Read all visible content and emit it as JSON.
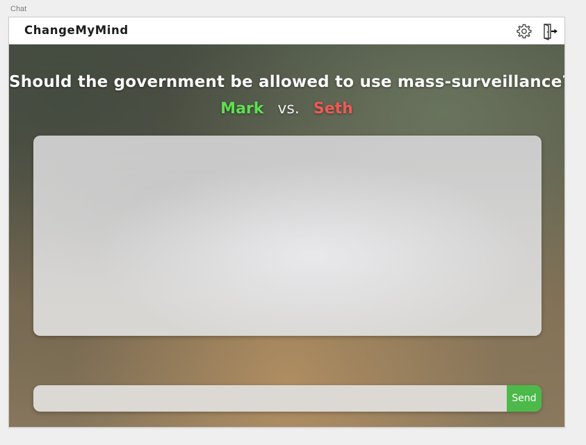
{
  "artboard": {
    "label": "Chat"
  },
  "header": {
    "brand": "ChangeMyMind",
    "settings_icon": "gear-icon",
    "exit_icon": "exit-door-icon"
  },
  "debate": {
    "question": "Should the government be allowed to use mass-surveillance?",
    "participant_a": "Mark",
    "vs_text": "vs.",
    "participant_b": "Seth",
    "colors": {
      "participant_a": "#5de04f",
      "participant_b": "#ee5a55"
    }
  },
  "composer": {
    "input_value": "",
    "input_placeholder": "",
    "send_label": "Send",
    "send_color": "#4cb94a"
  }
}
